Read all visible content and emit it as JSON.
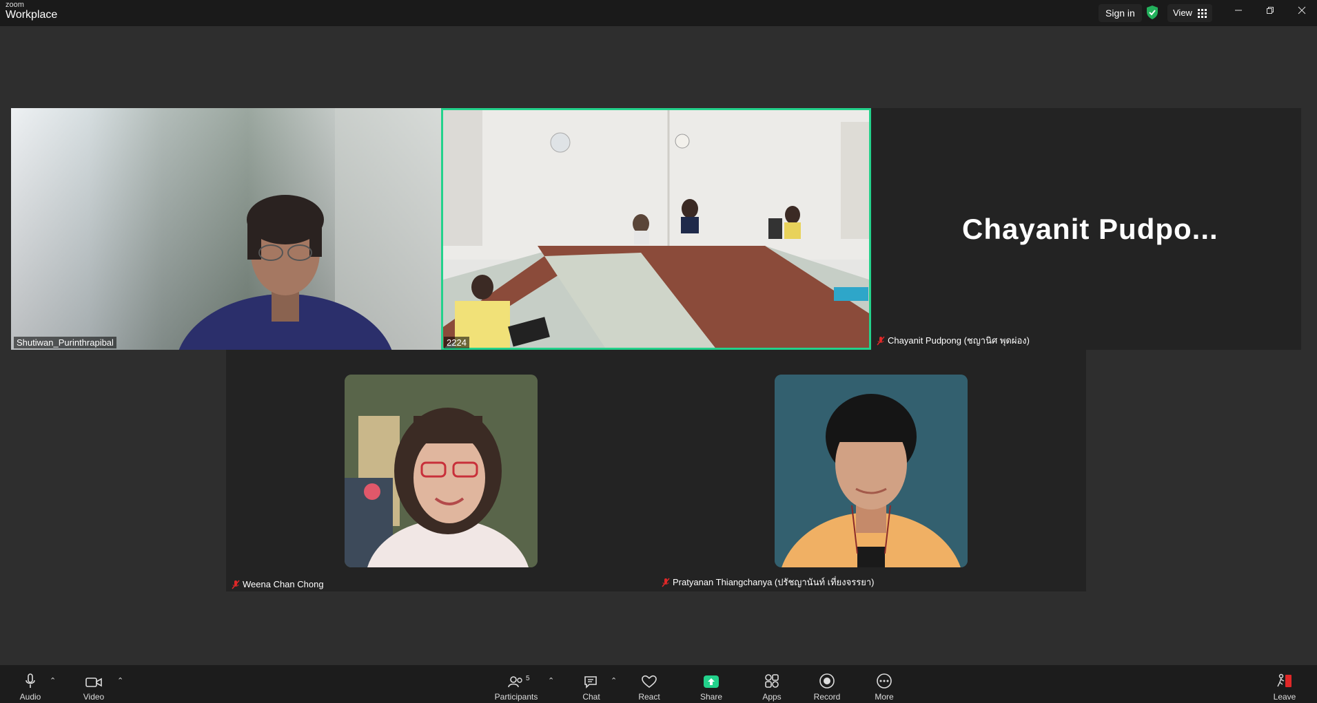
{
  "app": {
    "brand_small": "zoom",
    "brand_large": "Workplace"
  },
  "titlebar": {
    "sign_in": "Sign in",
    "view": "View"
  },
  "tiles": {
    "top_left": {
      "name": "Shutiwan_Purinthrapibal"
    },
    "top_center": {
      "name": "2224"
    },
    "top_right": {
      "name": "Chayanit Pudpong (ชญานิศ พุดผ่อง)",
      "display_name": "Chayanit  Pudpo..."
    },
    "bottom_left": {
      "name": "Weena Chan Chong"
    },
    "bottom_right": {
      "name": "Pratyanan Thiangchanya (ปรัชญานันท์ เที่ยงจรรยา)"
    }
  },
  "toolbar": {
    "audio": "Audio",
    "video": "Video",
    "participants": "Participants",
    "participants_count": "5",
    "chat": "Chat",
    "react": "React",
    "share": "Share",
    "apps": "Apps",
    "record": "Record",
    "more": "More",
    "leave": "Leave"
  },
  "colors": {
    "active_speaker": "#23d18b",
    "share": "#23d18b",
    "leave": "#e02828"
  }
}
